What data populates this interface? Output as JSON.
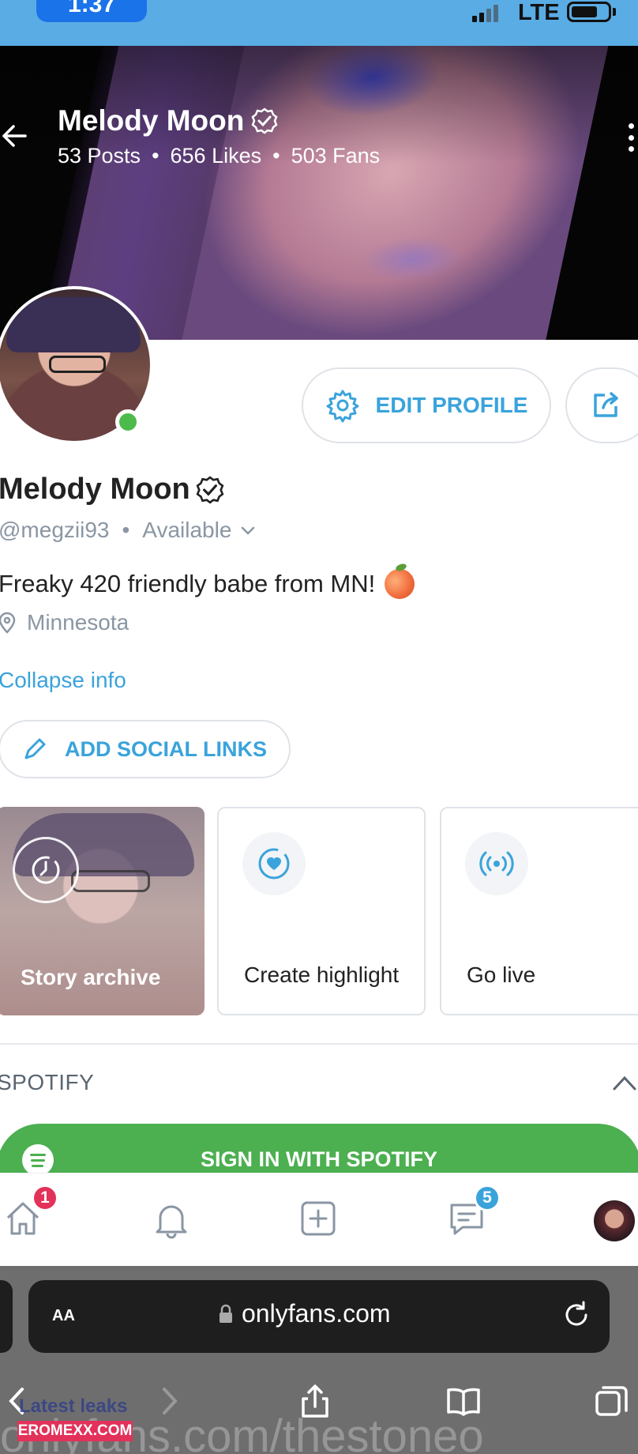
{
  "status_bar": {
    "time": "1:37",
    "network": "LTE"
  },
  "header": {
    "name": "Melody Moon",
    "posts": "53 Posts",
    "likes": "656 Likes",
    "fans": "503 Fans"
  },
  "profile": {
    "edit_label": "EDIT PROFILE",
    "display_name": "Melody Moon",
    "handle": "@megzii93",
    "availability": "Available",
    "bio": "Freaky 420 friendly babe from MN!",
    "location": "Minnesota",
    "collapse_label": "Collapse info",
    "social_label": "ADD SOCIAL LINKS"
  },
  "cards": {
    "archive": "Story archive",
    "highlight": "Create highlight",
    "live": "Go live"
  },
  "spotify": {
    "heading": "SPOTIFY",
    "button": "SIGN IN WITH SPOTIFY"
  },
  "tabbar": {
    "home_badge": "1",
    "messages_badge": "5"
  },
  "browser": {
    "text_size": "AA",
    "url": "onlyfans.com"
  },
  "watermarks": {
    "small": "Latest leaks",
    "brand": "EROMEXX.COM",
    "large": "onlyfans.com/thestoneo"
  },
  "colors": {
    "accent": "#3aa3db",
    "spotify": "#4caf50",
    "online": "#4cbb4c",
    "badge_red": "#e2325a",
    "badge_blue": "#3aa3db",
    "status_bar": "#5aace4"
  }
}
